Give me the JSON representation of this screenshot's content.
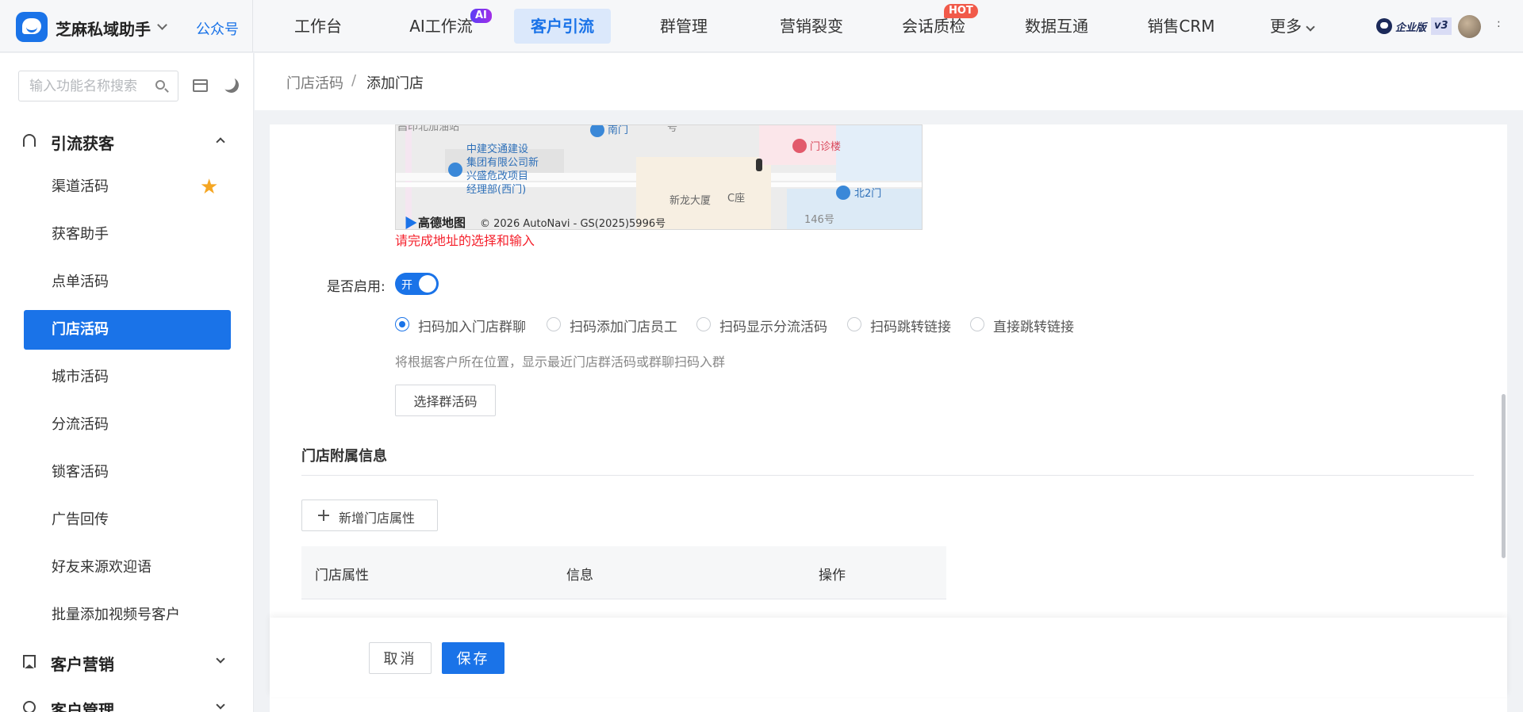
{
  "topbar": {
    "brand": "芝麻私域助手",
    "brand_sub": "公众号",
    "nav": [
      {
        "label": "工作台"
      },
      {
        "label": "AI工作流",
        "badge": "AI"
      },
      {
        "label": "客户引流",
        "active": true
      },
      {
        "label": "群管理"
      },
      {
        "label": "营销裂变"
      },
      {
        "label": "会话质检",
        "badge": "HOT"
      },
      {
        "label": "数据互通"
      },
      {
        "label": "销售CRM"
      },
      {
        "label": "更多"
      }
    ],
    "edition": "企业版",
    "version": "v3",
    "ellipsis": ":"
  },
  "sidebar": {
    "search_placeholder": "输入功能名称搜索",
    "groups": [
      {
        "label": "引流获客",
        "expanded": true,
        "icon": "user-plus-icon"
      },
      {
        "label": "客户营销",
        "expanded": false,
        "icon": "bookmark-icon"
      },
      {
        "label": "客户管理",
        "expanded": false,
        "icon": "clock-icon"
      }
    ],
    "items": [
      {
        "label": "渠道活码",
        "starred": true
      },
      {
        "label": "获客助手"
      },
      {
        "label": "点单活码"
      },
      {
        "label": "门店活码",
        "active": true
      },
      {
        "label": "城市活码"
      },
      {
        "label": "分流活码"
      },
      {
        "label": "锁客活码"
      },
      {
        "label": "广告回传"
      },
      {
        "label": "好友来源欢迎语"
      },
      {
        "label": "批量添加视频号客户"
      }
    ]
  },
  "breadcrumb": {
    "parent": "门店活码",
    "separator": "/",
    "current": "添加门店"
  },
  "map": {
    "labels": {
      "top_left": "昌印北加油站",
      "south_gate": "南门",
      "hao": "号",
      "outpatient": "门诊楼",
      "company_1": "中建交通建设",
      "company_2": "集团有限公司新",
      "company_3": "兴盛危改项目",
      "company_4": "经理部(西门)",
      "xinlong": "新龙大厦",
      "c_tower": "C座",
      "north2": "北2门",
      "no146": "146号"
    },
    "brand": "高德地图",
    "copyright": "© 2026 AutoNavi - GS(2025)5996号"
  },
  "form": {
    "address_error": "请完成地址的选择和输入",
    "enable_label": "是否启用:",
    "switch_text": "开",
    "switch_on": true,
    "radios": [
      {
        "label": "扫码加入门店群聊",
        "checked": true
      },
      {
        "label": "扫码添加门店员工",
        "checked": false
      },
      {
        "label": "扫码显示分流活码",
        "checked": false
      },
      {
        "label": "扫码跳转链接",
        "checked": false
      },
      {
        "label": "直接跳转链接",
        "checked": false
      }
    ],
    "hint": "将根据客户所在位置，显示最近门店群活码或群聊扫码入群",
    "select_group_button": "选择群活码"
  },
  "attributes": {
    "section_title": "门店附属信息",
    "add_button": "新增门店属性",
    "columns": [
      "门店属性",
      "信息",
      "操作"
    ]
  },
  "footer": {
    "cancel": "取消",
    "save": "保存"
  },
  "colors": {
    "primary": "#1a73e8",
    "error": "#f5222d",
    "star": "#f5a623",
    "hot": "#f15a4a"
  }
}
